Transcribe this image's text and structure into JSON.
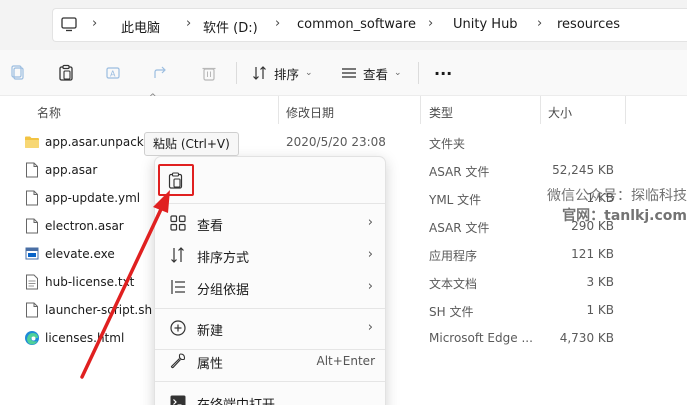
{
  "breadcrumb": [
    "此电脑",
    "软件 (D:)",
    "common_software",
    "Unity Hub",
    "resources"
  ],
  "toolbar": {
    "sort_label": "排序",
    "view_label": "查看",
    "more_label": "···"
  },
  "columns": {
    "name": "名称",
    "date": "修改日期",
    "type": "类型",
    "size": "大小"
  },
  "files": [
    {
      "name": "app.asar.unpacked",
      "date": "2020/5/20 23:08",
      "type": "文件夹",
      "size": "",
      "icon": "folder-icon"
    },
    {
      "name": "app.asar",
      "date": "",
      "type": "ASAR 文件",
      "size": "52,245 KB",
      "icon": "file-icon"
    },
    {
      "name": "app-update.yml",
      "date": "",
      "type": "YML 文件",
      "size": "1 KB",
      "icon": "file-icon"
    },
    {
      "name": "electron.asar",
      "date": "",
      "type": "ASAR 文件",
      "size": "290 KB",
      "icon": "file-icon"
    },
    {
      "name": "elevate.exe",
      "date": "",
      "type": "应用程序",
      "size": "121 KB",
      "icon": "exe-icon"
    },
    {
      "name": "hub-license.txt",
      "date": "",
      "type": "文本文档",
      "size": "3 KB",
      "icon": "text-file-icon"
    },
    {
      "name": "launcher-script.sh",
      "date": "",
      "type": "SH 文件",
      "size": "1 KB",
      "icon": "file-icon"
    },
    {
      "name": "licenses.html",
      "date": "",
      "type": "Microsoft Edge ...",
      "size": "4,730 KB",
      "icon": "edge-icon"
    }
  ],
  "tooltip": "粘贴 (Ctrl+V)",
  "context_menu": {
    "items": [
      {
        "label": "查看",
        "icon": "grid-icon",
        "submenu": true
      },
      {
        "label": "排序方式",
        "icon": "sort-icon",
        "submenu": true
      },
      {
        "label": "分组依据",
        "icon": "group-icon",
        "submenu": true
      },
      {
        "label": "新建",
        "icon": "plus-circle-icon",
        "submenu": true
      },
      {
        "label": "属性",
        "icon": "wrench-icon",
        "shortcut": "Alt+Enter"
      },
      {
        "label": "在终端中打开",
        "icon": "terminal-icon"
      }
    ]
  },
  "watermark": {
    "line1": "微信公众号：探临科技",
    "line2": "官网：tanlkj.com"
  },
  "colors": {
    "highlight": "#e02020",
    "folder": "#f2c342",
    "accent": "#0a64c8"
  }
}
